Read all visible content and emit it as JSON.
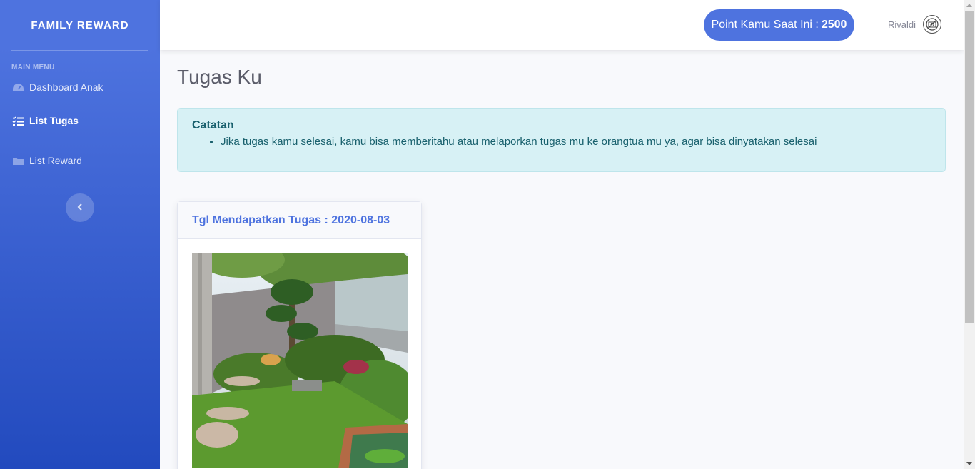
{
  "sidebar": {
    "brand": "FAMILY REWARD",
    "heading": "MAIN MENU",
    "items": [
      {
        "label": "Dashboard Anak",
        "icon": "tachometer-icon"
      },
      {
        "label": "List Tugas",
        "icon": "tasks-icon",
        "active": true
      },
      {
        "label": "List Reward",
        "icon": "folder-icon"
      }
    ]
  },
  "topbar": {
    "points_label": "Point Kamu Saat Ini :",
    "points_value": "2500",
    "user_name": "Rivaldi"
  },
  "main": {
    "title": "Tugas Ku",
    "alert": {
      "title": "Catatan",
      "items": [
        "Jika tugas kamu selesai, kamu bisa memberitahu atau melaporkan tugas mu ke orangtua mu ya, agar bisa dinyatakan selesai"
      ]
    },
    "cards": [
      {
        "header": "Tgl Mendapatkan Tugas : 2020-08-03",
        "image": "garden-photo"
      }
    ]
  },
  "colors": {
    "primary": "#4e73df",
    "info_bg": "#d7f1f5",
    "info_text": "#18606d"
  }
}
